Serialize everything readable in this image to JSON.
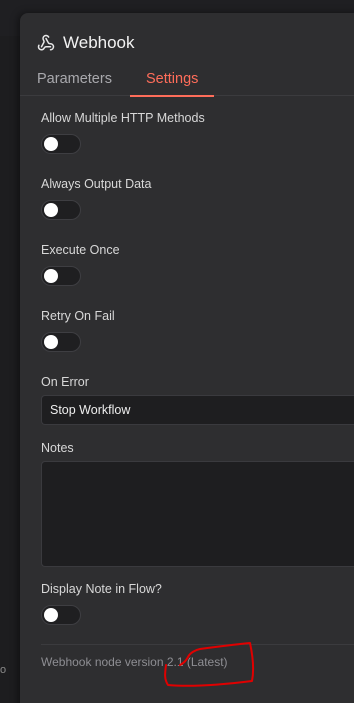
{
  "node": {
    "title": "Webhook",
    "icon": "webhook-icon"
  },
  "tabs": [
    {
      "label": "Parameters",
      "active": false
    },
    {
      "label": "Settings",
      "active": true
    }
  ],
  "settings": {
    "allow_multiple_methods": {
      "label": "Allow Multiple HTTP Methods",
      "value": false
    },
    "always_output_data": {
      "label": "Always Output Data",
      "value": false
    },
    "execute_once": {
      "label": "Execute Once",
      "value": false
    },
    "retry_on_fail": {
      "label": "Retry On Fail",
      "value": false
    },
    "on_error": {
      "label": "On Error",
      "value": "Stop Workflow"
    },
    "notes": {
      "label": "Notes",
      "value": ""
    },
    "display_note": {
      "label": "Display Note in Flow?",
      "value": false
    }
  },
  "footer": {
    "version_text": "Webhook node version 2.1 (Latest)"
  },
  "left_edge_glyph": "o",
  "colors": {
    "accent": "#ff6d5a",
    "annotation": "#e00000",
    "panel": "#2e2e30"
  }
}
